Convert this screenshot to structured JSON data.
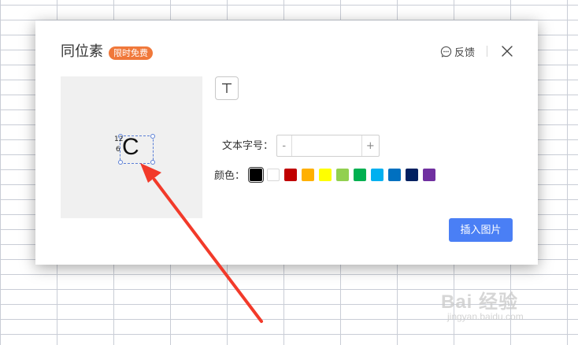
{
  "dialog": {
    "title": "同位素",
    "badge": "限时免费",
    "feedback_label": "反馈",
    "close_icon": "close-icon",
    "feedback_icon": "chat-bubble-icon"
  },
  "preview": {
    "main_char": "C",
    "superscript": "12",
    "subscript": "6"
  },
  "tools": {
    "text_tool_icon": "text-t-icon"
  },
  "font_size": {
    "label": "文本字号：",
    "minus": "-",
    "plus": "+",
    "value": "",
    "placeholder": ""
  },
  "colors": {
    "label": "颜色：",
    "swatches": [
      "#000000",
      "#ffffff",
      "#c00000",
      "#ffb000",
      "#ffff00",
      "#92d050",
      "#00b050",
      "#00b0f0",
      "#0070c0",
      "#002060",
      "#7030a0"
    ],
    "selected_index": 0
  },
  "actions": {
    "insert_label": "插入图片"
  },
  "annotation": {
    "arrow_color": "#f23a2a"
  },
  "watermark": {
    "text": "Bai 经验",
    "sub": "jingyan.baidu.com"
  }
}
